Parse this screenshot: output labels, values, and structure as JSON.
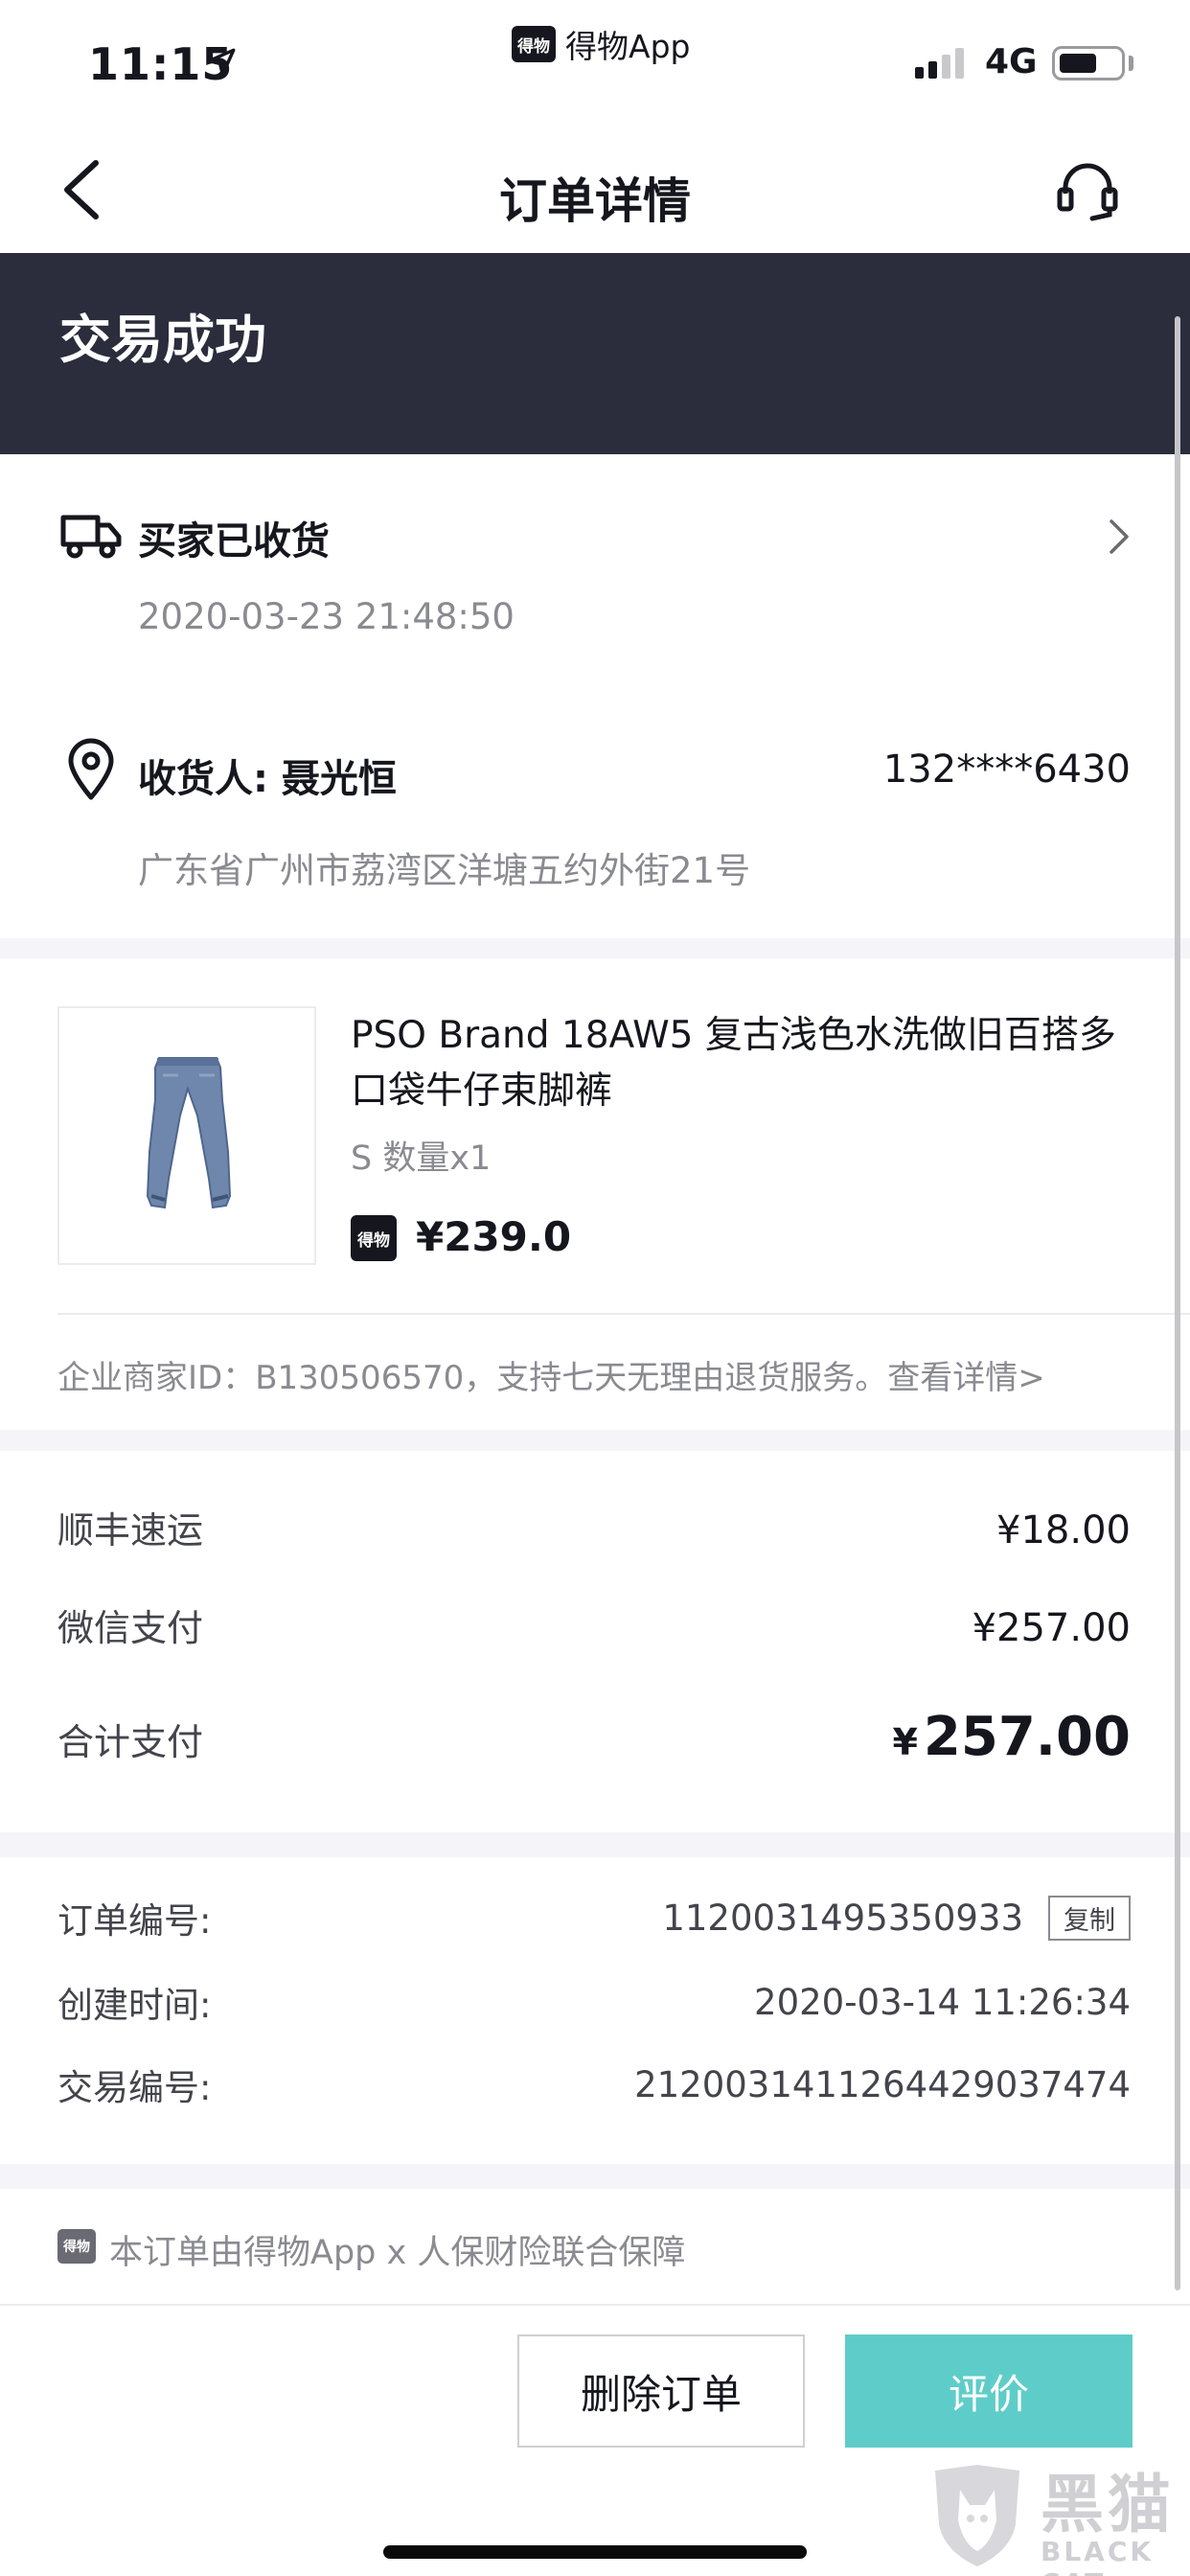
{
  "status_bar": {
    "time": "11:15",
    "app_logo_text": "得物",
    "app_name": "得物App",
    "network": "4G",
    "signal_bars": 2,
    "signal_total": 4
  },
  "nav": {
    "title": "订单详情",
    "back_icon": "chevron-left-icon",
    "service_icon": "headset-icon"
  },
  "status_header": {
    "text": "交易成功"
  },
  "logistics": {
    "status": "买家已收货",
    "time": "2020-03-23 21:48:50",
    "receiver": "收货人: 聂光恒",
    "phone": "132****6430",
    "address": "广东省广州市荔湾区洋塘五约外街21号"
  },
  "product": {
    "title": "PSO Brand 18AW5 复古浅色水洗做旧百搭多口袋牛仔束脚裤",
    "spec": "S 数量x1",
    "badge_text": "得物",
    "price": "¥239.0",
    "merchant_note": "企业商家ID：B130506570，支持七天无理由退货服务。查看详情>"
  },
  "payment": {
    "rows": [
      {
        "label": "顺丰速运",
        "value": "¥18.00"
      },
      {
        "label": "微信支付",
        "value": "¥257.00"
      }
    ],
    "total_label": "合计支付",
    "total_currency": "¥",
    "total_value": "257.00"
  },
  "order_info": {
    "order_no_label": "订单编号:",
    "order_no": "1120031495350933",
    "copy_label": "复制",
    "created_label": "创建时间:",
    "created": "2020-03-14 11:26:34",
    "trade_no_label": "交易编号:",
    "trade_no": "2120031411264429037474"
  },
  "insurance": {
    "logo_text": "得物",
    "text": "本订单由得物App x 人保财险联合保障"
  },
  "actions": {
    "delete_label": "删除订单",
    "review_label": "评价"
  },
  "watermark": {
    "big": "黑猫",
    "small": "BLACK CAT"
  },
  "colors": {
    "header_bg": "#2b2d3c",
    "accent_teal": "#5ecdc9",
    "muted_text": "#8a8a91",
    "section_gap": "#f5f5f9"
  }
}
